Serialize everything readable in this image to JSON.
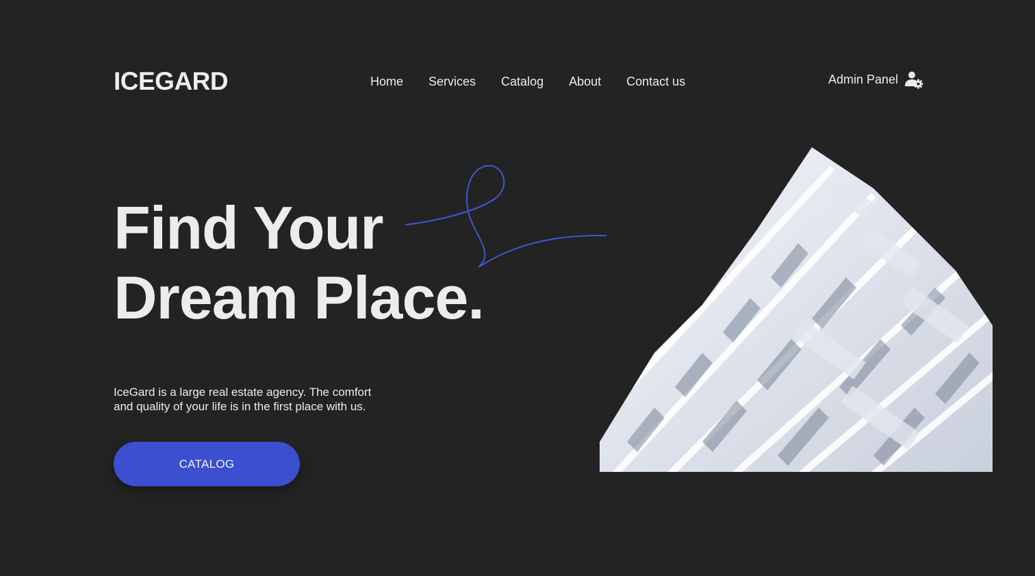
{
  "brand": {
    "logo": "ICEGARD"
  },
  "nav": {
    "items": [
      {
        "label": "Home"
      },
      {
        "label": "Services"
      },
      {
        "label": "Catalog"
      },
      {
        "label": "About"
      },
      {
        "label": "Contact us"
      }
    ]
  },
  "admin": {
    "label": "Admin Panel",
    "icon": "user-gear-icon"
  },
  "hero": {
    "title_line1": "Find Your",
    "title_line2": "Dream Place.",
    "description_line1": "IceGard is a large real estate agency. The comfort",
    "description_line2": "and quality of your life is in the first place with us.",
    "cta_label": "CATALOG"
  },
  "colors": {
    "background": "#232323",
    "accent": "#3b4fcf",
    "text": "#ececec"
  }
}
